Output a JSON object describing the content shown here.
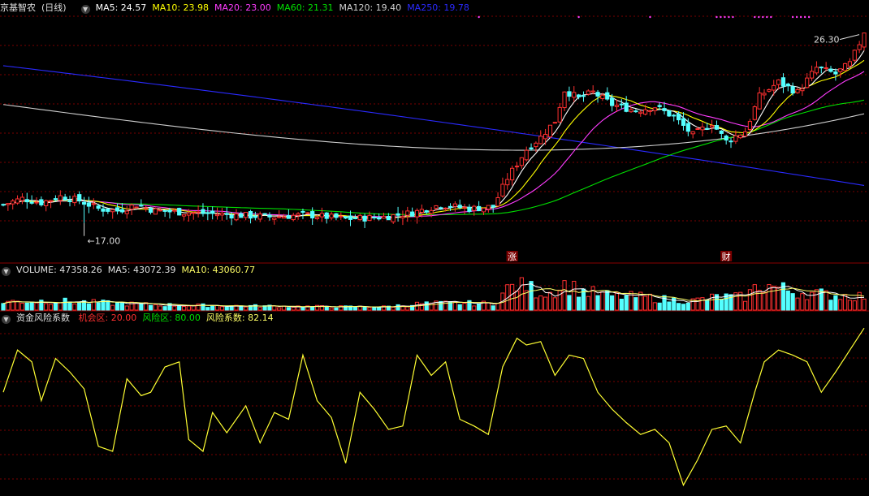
{
  "stock": {
    "name": "京基智农",
    "period": "(日线)"
  },
  "price_panel": {
    "ma": [
      {
        "label": "MA5: 24.57",
        "color": "#ffffff"
      },
      {
        "label": "MA10: 23.98",
        "color": "#ffff00"
      },
      {
        "label": "MA20: 23.00",
        "color": "#ff3cff"
      },
      {
        "label": "MA60: 21.31",
        "color": "#00e000"
      },
      {
        "label": "MA120: 19.40",
        "color": "#cfcfcf"
      },
      {
        "label": "MA250: 19.78",
        "color": "#2a2aff"
      }
    ],
    "high_label": "26.30",
    "low_label": "17.00",
    "markers": [
      {
        "text": "涨",
        "bar": 107
      },
      {
        "text": "财",
        "bar": 152
      }
    ]
  },
  "volume_panel": {
    "labels": [
      {
        "label": "VOLUME: 47358.26",
        "color": "#e0e0e0"
      },
      {
        "label": "MA5: 43072.39",
        "color": "#e0e0e0"
      },
      {
        "label": "MA10: 43060.77",
        "color": "#ffff66"
      }
    ]
  },
  "risk_panel": {
    "name": "资金风险系数",
    "labels": [
      {
        "label": "机会区: 20.00",
        "color": "#ff3030"
      },
      {
        "label": "风险区: 80.00",
        "color": "#00e000"
      },
      {
        "label": "风险系数: 82.14",
        "color": "#ffff66"
      }
    ]
  },
  "colors": {
    "up": "#ff3030",
    "down": "#54ffff",
    "grid": "#7a0000",
    "risk_line": "#ffff33"
  },
  "chart_data": {
    "type": "candlestick",
    "bars": 182,
    "price_range": [
      15.2,
      27.2
    ],
    "ohlc_keypoints": [
      [
        0,
        17.9
      ],
      [
        4,
        18.2
      ],
      [
        8,
        18.0
      ],
      [
        12,
        18.3
      ],
      [
        16,
        18.1
      ],
      [
        20,
        17.7
      ],
      [
        24,
        17.6
      ],
      [
        28,
        17.9
      ],
      [
        32,
        17.6
      ],
      [
        40,
        17.5
      ],
      [
        48,
        17.4
      ],
      [
        56,
        17.3
      ],
      [
        64,
        17.4
      ],
      [
        72,
        17.2
      ],
      [
        80,
        17.3
      ],
      [
        86,
        17.5
      ],
      [
        92,
        17.9
      ],
      [
        98,
        17.7
      ],
      [
        103,
        17.8
      ],
      [
        106,
        19.2
      ],
      [
        110,
        20.6
      ],
      [
        113,
        21.2
      ],
      [
        116,
        22.0
      ],
      [
        118,
        23.5
      ],
      [
        121,
        23.1
      ],
      [
        124,
        23.4
      ],
      [
        128,
        22.8
      ],
      [
        133,
        22.5
      ],
      [
        137,
        22.7
      ],
      [
        141,
        22.2
      ],
      [
        145,
        21.3
      ],
      [
        149,
        21.9
      ],
      [
        152,
        21.0
      ],
      [
        156,
        21.5
      ],
      [
        159,
        23.2
      ],
      [
        163,
        23.9
      ],
      [
        167,
        23.4
      ],
      [
        171,
        24.6
      ],
      [
        175,
        24.3
      ],
      [
        178,
        24.8
      ],
      [
        181,
        26.3
      ]
    ],
    "volume_keypoints": [
      [
        0,
        18
      ],
      [
        10,
        20
      ],
      [
        20,
        16
      ],
      [
        30,
        12
      ],
      [
        40,
        10
      ],
      [
        50,
        9
      ],
      [
        60,
        8
      ],
      [
        70,
        7
      ],
      [
        80,
        7
      ],
      [
        88,
        14
      ],
      [
        96,
        15
      ],
      [
        103,
        14
      ],
      [
        106,
        45
      ],
      [
        109,
        60
      ],
      [
        112,
        40
      ],
      [
        115,
        38
      ],
      [
        118,
        55
      ],
      [
        122,
        40
      ],
      [
        128,
        30
      ],
      [
        135,
        28
      ],
      [
        140,
        22
      ],
      [
        145,
        20
      ],
      [
        150,
        28
      ],
      [
        156,
        28
      ],
      [
        159,
        55
      ],
      [
        162,
        50
      ],
      [
        166,
        40
      ],
      [
        170,
        36
      ],
      [
        175,
        32
      ],
      [
        181,
        30
      ]
    ],
    "risk_keypoints": [
      [
        0,
        60
      ],
      [
        3,
        85
      ],
      [
        6,
        78
      ],
      [
        8,
        55
      ],
      [
        11,
        80
      ],
      [
        14,
        72
      ],
      [
        17,
        62
      ],
      [
        20,
        28
      ],
      [
        23,
        25
      ],
      [
        26,
        68
      ],
      [
        29,
        58
      ],
      [
        31,
        60
      ],
      [
        34,
        75
      ],
      [
        37,
        78
      ],
      [
        39,
        32
      ],
      [
        42,
        25
      ],
      [
        44,
        48
      ],
      [
        47,
        36
      ],
      [
        51,
        52
      ],
      [
        54,
        30
      ],
      [
        57,
        48
      ],
      [
        60,
        44
      ],
      [
        63,
        82
      ],
      [
        66,
        55
      ],
      [
        69,
        45
      ],
      [
        72,
        18
      ],
      [
        75,
        60
      ],
      [
        78,
        50
      ],
      [
        81,
        38
      ],
      [
        84,
        40
      ],
      [
        87,
        82
      ],
      [
        90,
        70
      ],
      [
        93,
        78
      ],
      [
        96,
        44
      ],
      [
        99,
        40
      ],
      [
        102,
        35
      ],
      [
        105,
        75
      ],
      [
        108,
        92
      ],
      [
        110,
        88
      ],
      [
        113,
        90
      ],
      [
        116,
        70
      ],
      [
        119,
        82
      ],
      [
        122,
        80
      ],
      [
        125,
        60
      ],
      [
        128,
        50
      ],
      [
        131,
        42
      ],
      [
        134,
        35
      ],
      [
        137,
        38
      ],
      [
        140,
        30
      ],
      [
        143,
        5
      ],
      [
        146,
        20
      ],
      [
        149,
        38
      ],
      [
        152,
        40
      ],
      [
        155,
        30
      ],
      [
        158,
        60
      ],
      [
        160,
        78
      ],
      [
        163,
        85
      ],
      [
        166,
        82
      ],
      [
        169,
        78
      ],
      [
        172,
        60
      ],
      [
        175,
        72
      ],
      [
        178,
        85
      ],
      [
        181,
        98
      ]
    ],
    "ylim_risk": [
      0,
      100
    ]
  }
}
